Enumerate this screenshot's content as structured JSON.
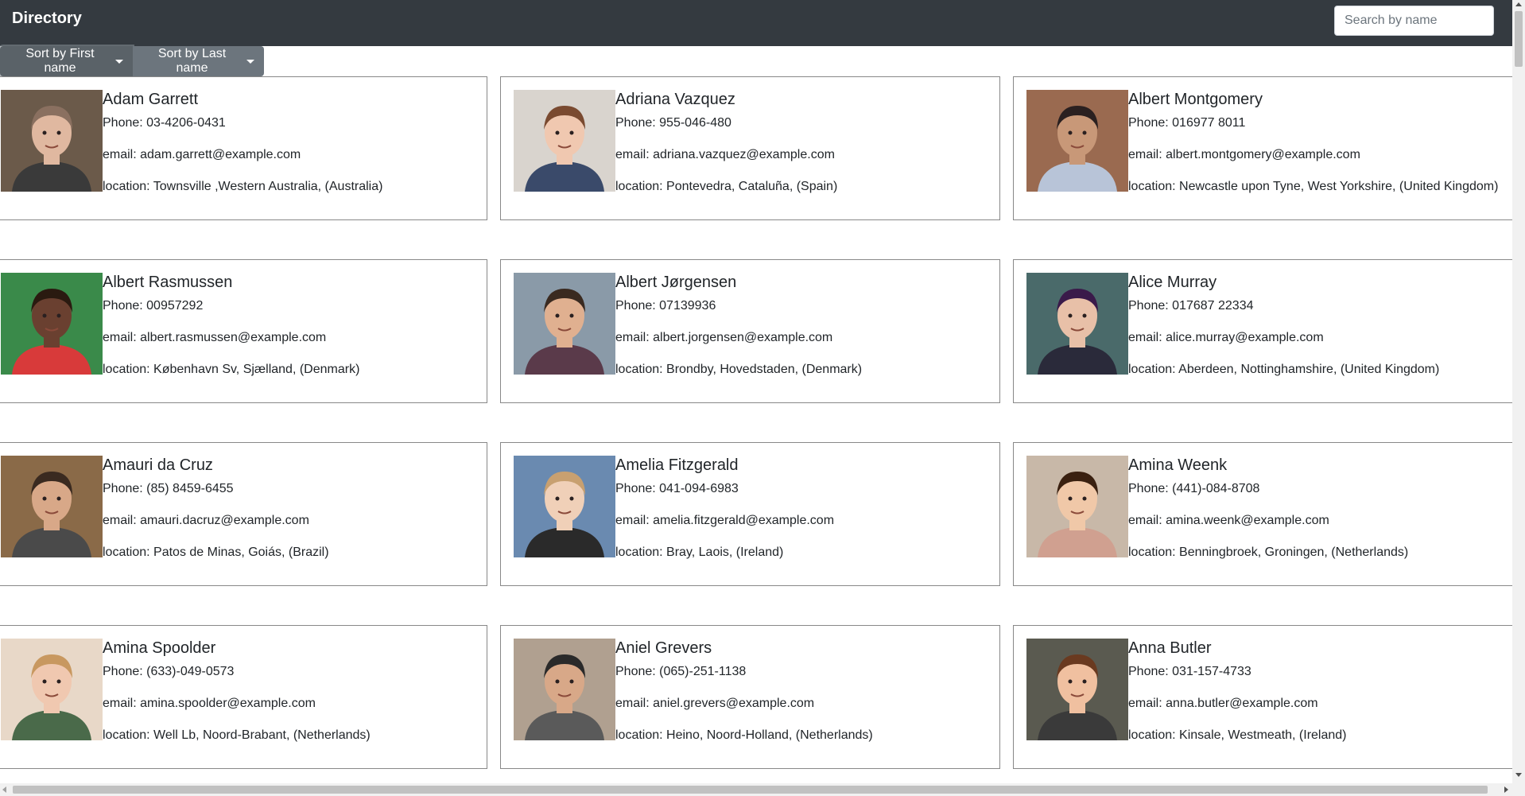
{
  "header": {
    "brand": "Directory",
    "search_placeholder": "Search by name"
  },
  "sort": {
    "first_label": "Sort by First name",
    "last_label": "Sort by Last name"
  },
  "people": [
    {
      "name": "Adam Garrett",
      "phone": "Phone: 03-4206-0431",
      "email": "email: adam.garrett@example.com",
      "location": "location: Townsville ,Western Australia, (Australia)",
      "bg": "#6b5a4a",
      "skin": "#e0b8a0",
      "hair": "#8a7060",
      "shirt": "#3a3a3a"
    },
    {
      "name": "Adriana Vazquez",
      "phone": "Phone: 955-046-480",
      "email": "email: adriana.vazquez@example.com",
      "location": "location: Pontevedra, Cataluña, (Spain)",
      "bg": "#d9d4ce",
      "skin": "#f0c8b0",
      "hair": "#7a4a30",
      "shirt": "#3a4a6a"
    },
    {
      "name": "Albert Montgomery",
      "phone": "Phone: 016977 8011",
      "email": "email: albert.montgomery@example.com",
      "location": "location: Newcastle upon Tyne, West Yorkshire, (United Kingdom)",
      "bg": "#9a6a50",
      "skin": "#c89878",
      "hair": "#2a2020",
      "shirt": "#b8c4d8"
    },
    {
      "name": "Albert Rasmussen",
      "phone": "Phone: 00957292",
      "email": "email: albert.rasmussen@example.com",
      "location": "location: København Sv, Sjælland, (Denmark)",
      "bg": "#3a8a4a",
      "skin": "#6a4030",
      "hair": "#2a1a10",
      "shirt": "#d83a3a"
    },
    {
      "name": "Albert Jørgensen",
      "phone": "Phone: 07139936",
      "email": "email: albert.jorgensen@example.com",
      "location": "location: Brondby, Hovedstaden, (Denmark)",
      "bg": "#8a9aa8",
      "skin": "#e0b090",
      "hair": "#3a2a20",
      "shirt": "#5a3a4a"
    },
    {
      "name": "Alice Murray",
      "phone": "Phone: 017687 22334",
      "email": "email: alice.murray@example.com",
      "location": "location: Aberdeen, Nottinghamshire, (United Kingdom)",
      "bg": "#4a6a6a",
      "skin": "#e8c0a8",
      "hair": "#3a1a4a",
      "shirt": "#2a2a3a"
    },
    {
      "name": "Amauri da Cruz",
      "phone": "Phone: (85) 8459-6455",
      "email": "email: amauri.dacruz@example.com",
      "location": "location: Patos de Minas, Goiás, (Brazil)",
      "bg": "#8a6a48",
      "skin": "#d8a888",
      "hair": "#3a2a20",
      "shirt": "#4a4a4a"
    },
    {
      "name": "Amelia Fitzgerald",
      "phone": "Phone: 041-094-6983",
      "email": "email: amelia.fitzgerald@example.com",
      "location": "location: Bray, Laois, (Ireland)",
      "bg": "#6a8ab0",
      "skin": "#f0d0b8",
      "hair": "#c8a070",
      "shirt": "#2a2a2a"
    },
    {
      "name": "Amina Weenk",
      "phone": "Phone: (441)-084-8708",
      "email": "email: amina.weenk@example.com",
      "location": "location: Benningbroek, Groningen, (Netherlands)",
      "bg": "#c8b8a8",
      "skin": "#f0c8a8",
      "hair": "#3a2010",
      "shirt": "#d0a090"
    },
    {
      "name": "Amina Spoolder",
      "phone": "Phone: (633)-049-0573",
      "email": "email: amina.spoolder@example.com",
      "location": "location: Well Lb, Noord-Brabant, (Netherlands)",
      "bg": "#e8d8c8",
      "skin": "#f0c8b0",
      "hair": "#c89860",
      "shirt": "#4a6a4a"
    },
    {
      "name": "Aniel Grevers",
      "phone": "Phone: (065)-251-1138",
      "email": "email: aniel.grevers@example.com",
      "location": "location: Heino, Noord-Holland, (Netherlands)",
      "bg": "#b0a090",
      "skin": "#d8a888",
      "hair": "#2a2a2a",
      "shirt": "#5a5a5a"
    },
    {
      "name": "Anna Butler",
      "phone": "Phone: 031-157-4733",
      "email": "email: anna.butler@example.com",
      "location": "location: Kinsale, Westmeath, (Ireland)",
      "bg": "#5a5a50",
      "skin": "#f0c0a0",
      "hair": "#6a3a20",
      "shirt": "#3a3a3a"
    }
  ]
}
